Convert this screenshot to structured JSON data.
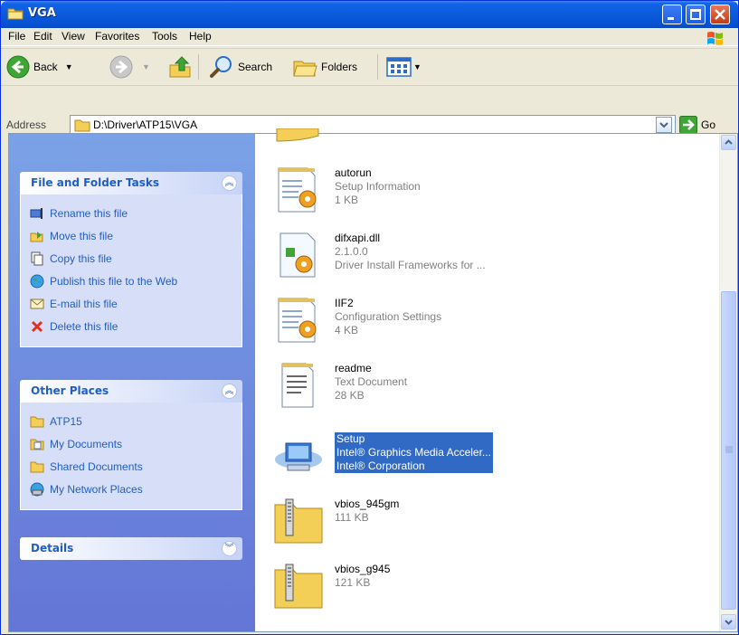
{
  "window": {
    "title": "VGA"
  },
  "menu": [
    "File",
    "Edit",
    "View",
    "Favorites",
    "Tools",
    "Help"
  ],
  "toolbar": {
    "back": "Back",
    "search": "Search",
    "folders": "Folders"
  },
  "address": {
    "label": "Address",
    "path": "D:\\Driver\\ATP15\\VGA",
    "go": "Go"
  },
  "task_pane": {
    "file_tasks": {
      "title": "File and Folder Tasks",
      "items": [
        "Rename this file",
        "Move this file",
        "Copy this file",
        "Publish this file to the Web",
        "E-mail this file",
        "Delete this file"
      ]
    },
    "other_places": {
      "title": "Other Places",
      "items": [
        "ATP15",
        "My Documents",
        "Shared Documents",
        "My Network Places"
      ]
    },
    "details": {
      "title": "Details"
    }
  },
  "files": [
    {
      "name": "autorun",
      "line2": "Setup Information",
      "line3": "1 KB",
      "icon": "setup-info-icon"
    },
    {
      "name": "difxapi.dll",
      "line2": "2.1.0.0",
      "line3": "Driver Install Frameworks for ...",
      "icon": "dll-icon"
    },
    {
      "name": "IIF2",
      "line2": "Configuration Settings",
      "line3": "4 KB",
      "icon": "config-settings-icon"
    },
    {
      "name": "readme",
      "line2": "Text Document",
      "line3": "28 KB",
      "icon": "text-document-icon"
    },
    {
      "name": "Setup",
      "line2": "Intel® Graphics Media Acceler...",
      "line3": "Intel® Corporation",
      "icon": "setup-computer-icon",
      "selected": true
    },
    {
      "name": "vbios_945gm",
      "line2": "111 KB",
      "line3": "",
      "icon": "zip-folder-icon"
    },
    {
      "name": "vbios_g945",
      "line2": "121 KB",
      "line3": "",
      "icon": "zip-folder-icon"
    }
  ]
}
